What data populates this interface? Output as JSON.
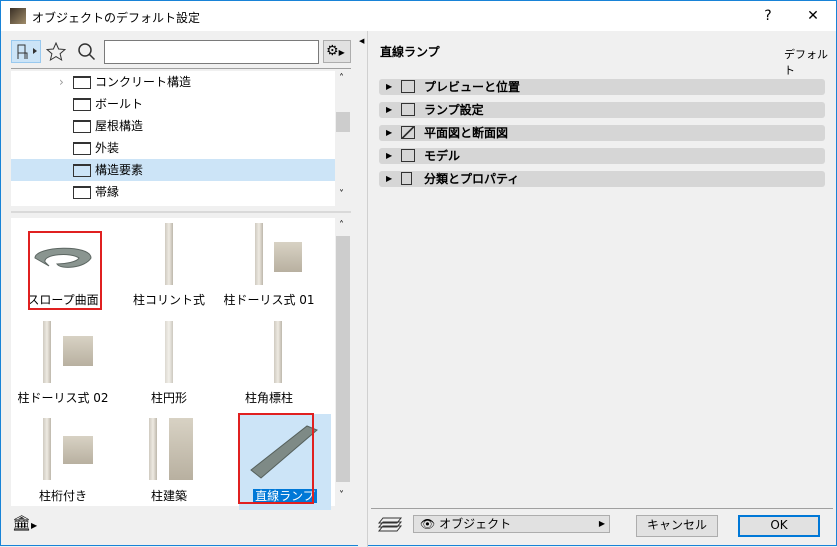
{
  "window": {
    "title": "オブジェクトのデフォルト設定",
    "help": "?",
    "close": "✕"
  },
  "tree": {
    "items": [
      {
        "label": "コンクリート構造",
        "expandable": true
      },
      {
        "label": "ボールト"
      },
      {
        "label": "屋根構造"
      },
      {
        "label": "外装"
      },
      {
        "label": "構造要素",
        "selected": true
      },
      {
        "label": "帯縁"
      }
    ]
  },
  "search": {
    "value": "",
    "placeholder": ""
  },
  "library": {
    "items": [
      {
        "label": "スロープ曲面",
        "highlighted": true
      },
      {
        "label": "柱コリント式"
      },
      {
        "label": "柱ドーリス式 01"
      },
      {
        "label": "柱ドーリス式 02"
      },
      {
        "label": "柱円形"
      },
      {
        "label": "柱角標柱"
      },
      {
        "label": "柱桁付き"
      },
      {
        "label": "柱建築"
      },
      {
        "label": "直線ランプ",
        "selected": true,
        "highlighted": true
      }
    ]
  },
  "settings": {
    "object_name": "直線ランプ",
    "mode": "デフォルト",
    "sections": [
      {
        "label": "プレビューと位置",
        "icon": "preview-position-icon"
      },
      {
        "label": "ランプ設定",
        "icon": "ramp-settings-icon"
      },
      {
        "label": "平面図と断面図",
        "icon": "floor-plan-section-icon"
      },
      {
        "label": "モデル",
        "icon": "model-cube-icon"
      },
      {
        "label": "分類とプロパティ",
        "icon": "classification-icon"
      }
    ]
  },
  "footer": {
    "layer": "オブジェクト",
    "cancel": "キャンセル",
    "ok": "OK"
  },
  "colors": {
    "selection": "#cce4f7",
    "accent": "#0078d7",
    "highlight_box": "#e02020"
  }
}
